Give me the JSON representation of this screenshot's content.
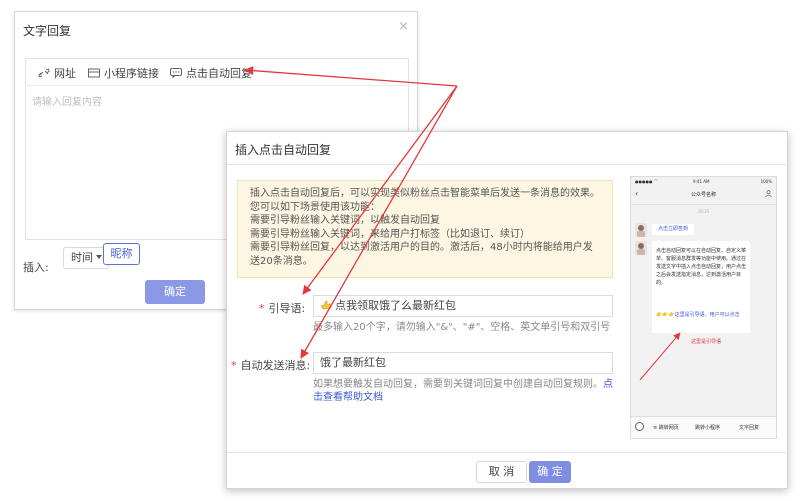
{
  "dialog_text_reply": {
    "title": "文字回复",
    "close_glyph": "×",
    "toolbar": {
      "link_label": "网址",
      "mini_program_label": "小程序链接",
      "auto_reply_label": "点击自动回复"
    },
    "placeholder": "请输入回复内容",
    "insert_label": "插入:",
    "time_select": "时间",
    "nickname_button": "昵称",
    "confirm_button": "确定"
  },
  "dialog_insert_auto_reply": {
    "title": "插入点击自动回复",
    "notice_lines": [
      "插入点击自动回复后，可以实现类似粉丝点击智能菜单后发送一条消息的效果。",
      "您可以如下场景使用该功能：",
      "需要引导粉丝输入关键词，以触发自动回复",
      "需要引导粉丝输入关键词，来给用户打标签（比如退订、续订）",
      "需要引导粉丝回复，以达到激活用户的目的。激活后，48小时内将能给用户发送20条消息。"
    ],
    "guide_label": "引导语:",
    "guide_value": "点我领取饿了么最新红包",
    "guide_hint": "最多输入20个字，请勿输入\"&\"、\"#\"、空格、英文单引号和双引号",
    "message_label": "自动发送消息:",
    "message_value": "饿了最新红包",
    "message_hint": "如果想要触发自动回复，需要到关键词回复中创建自动回复规则。",
    "help_link": "点击查看帮助文档",
    "cancel_button": "取 消",
    "ok_button": "确 定"
  },
  "phone_preview": {
    "status_signal": "●●●●● ⌒",
    "status_time": "9:41 AM",
    "status_battery": "100%",
    "header_title": "公众号名称",
    "date": "16:35",
    "bubble_short": "点击立即签到",
    "bubble_long_text": "点击自动回复可以在自动回复、自定义菜单、客服消息群发等功能中使用。通过在发送文字中插入点击自动回复，用户点击之后会发送指定消息，达到激活用户目的。",
    "bubble_long_link": "👉👉👉这里是引导语，用户可以点击",
    "red_label": "这里是引导语",
    "menu_items": [
      "≡ 跳转网页",
      "跳转小程序",
      "文字回复"
    ]
  },
  "colors": {
    "primary": "#7f8de3",
    "link": "#3d5ad2",
    "annotation_red": "#e4393c",
    "notice_bg": "#fdf6e3"
  }
}
